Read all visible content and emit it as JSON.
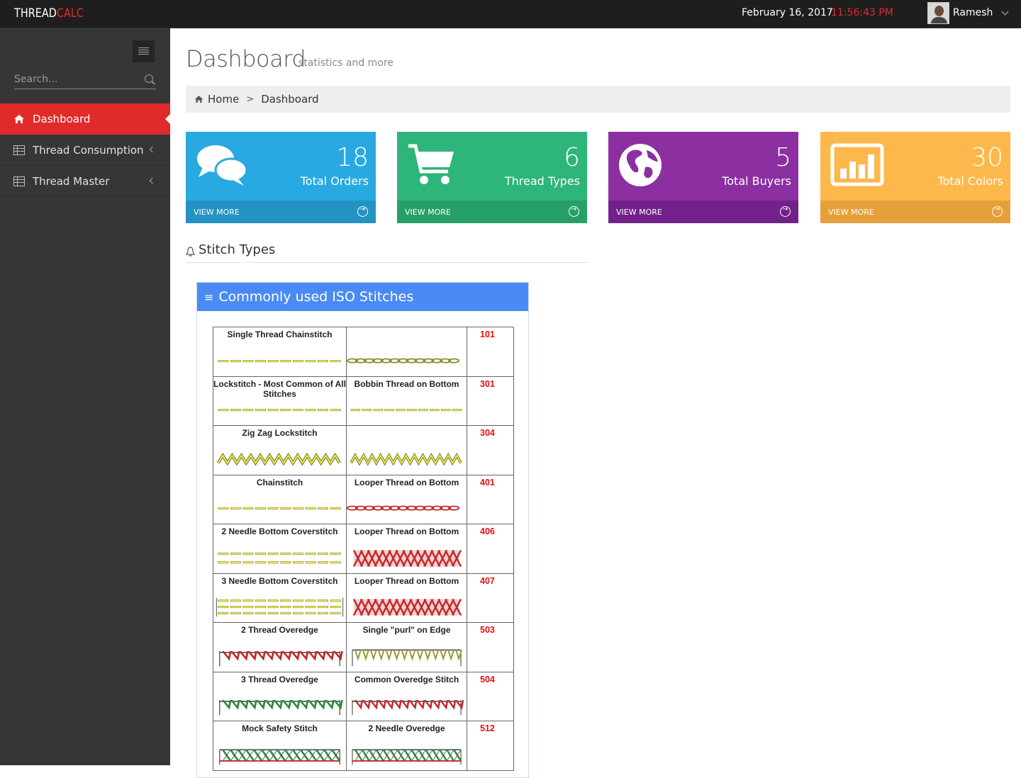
{
  "header": {
    "logo_a": "THREAD",
    "logo_b": "CALC",
    "date": "February 16, 2017",
    "time": "11:56:43 PM",
    "user_name": "Ramesh"
  },
  "sidebar": {
    "search_placeholder": "Search...",
    "items": [
      {
        "label": "Dashboard"
      },
      {
        "label": "Thread Consumption"
      },
      {
        "label": "Thread Master"
      }
    ]
  },
  "page": {
    "title": "Dashboard",
    "subtitle": "statistics and more",
    "breadcrumb": [
      "Home",
      "Dashboard"
    ]
  },
  "cards": [
    {
      "value": "18",
      "label": "Total Orders",
      "link": "VIEW MORE",
      "color": "#29a9e1",
      "foot_color": "#2393c4",
      "icon": "comments-icon"
    },
    {
      "value": "6",
      "label": "Thread Types",
      "link": "VIEW MORE",
      "color": "#2db57a",
      "foot_color": "#27a068",
      "icon": "cart-icon"
    },
    {
      "value": "5",
      "label": "Total Buyers",
      "link": "VIEW MORE",
      "color": "#8b2fa1",
      "foot_color": "#72218b",
      "icon": "globe-icon"
    },
    {
      "value": "30",
      "label": "Total Colors",
      "link": "VIEW MORE",
      "color": "#fdb84c",
      "foot_color": "#e5a03a",
      "icon": "bar-chart-icon"
    }
  ],
  "section": {
    "title": "Stitch Types"
  },
  "panel": {
    "title": "Commonly used ISO Stitches",
    "rows": [
      {
        "name": "Single Thread Chainstitch",
        "desc": "",
        "code": "101"
      },
      {
        "name": "Lockstitch - Most Common of All Stitches",
        "desc": "Bobbin Thread on Bottom",
        "code": "301"
      },
      {
        "name": "Zig Zag Lockstitch",
        "desc": "",
        "code": "304"
      },
      {
        "name": "Chainstitch",
        "desc": "Looper Thread on Bottom",
        "code": "401"
      },
      {
        "name": "2 Needle Bottom Coverstitch",
        "desc": "Looper Thread on Bottom",
        "code": "406"
      },
      {
        "name": "3 Needle Bottom Coverstitch",
        "desc": "Looper Thread on Bottom",
        "code": "407"
      },
      {
        "name": "2 Thread Overedge",
        "desc": "Single \"purl\" on Edge",
        "code": "503"
      },
      {
        "name": "3 Thread Overedge",
        "desc": "Common Overedge Stitch",
        "code": "504"
      },
      {
        "name": "Mock Safety Stitch",
        "desc": "2 Needle Overedge",
        "code": "512"
      }
    ]
  }
}
